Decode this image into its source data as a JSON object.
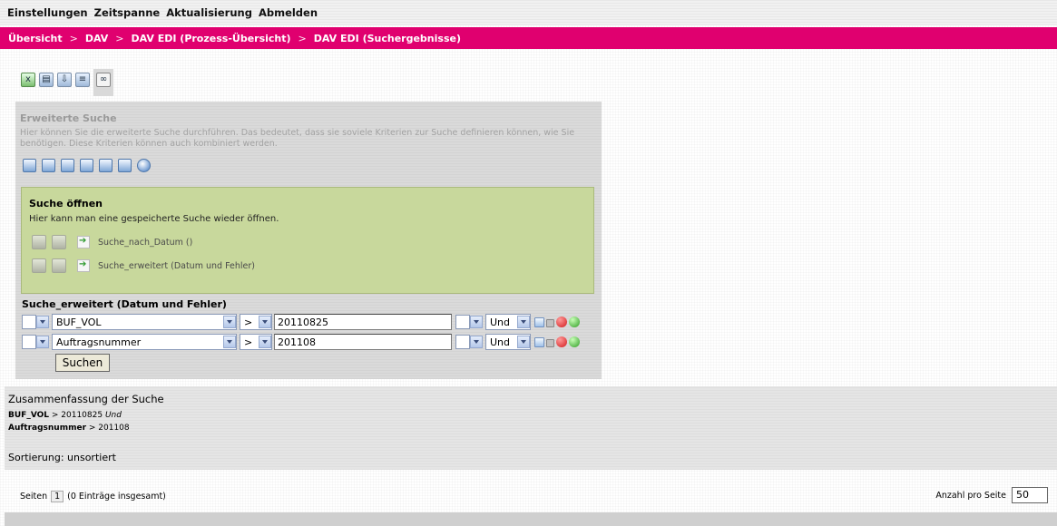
{
  "menu": [
    "Einstellungen",
    "Zeitspanne",
    "Aktualisierung",
    "Abmelden"
  ],
  "breadcrumbs": [
    "Übersicht",
    "DAV",
    "DAV EDI (Prozess-Übersicht)",
    "DAV EDI (Suchergebnisse)"
  ],
  "breadcrumb_separator": ">",
  "top_tools": [
    "excel-export-icon",
    "excel-icon",
    "import-icon",
    "list-view-icon",
    "binoculars-icon"
  ],
  "advanced": {
    "title": "Erweiterte Suche",
    "description": "Hier können Sie die erweiterte Suche durchführen. Das bedeutet, dass sie soviele Kriterien zur Suche definieren können, wie Sie benötigen. Diese Kriterien können auch kombiniert werden.",
    "tools": [
      "open-search-icon",
      "edit-search-icon",
      "save-search-icon",
      "add-criteria-icon",
      "remove-criteria-icon",
      "copy-icon",
      "help-icon"
    ]
  },
  "open_search": {
    "title": "Suche öffnen",
    "description": "Hier kann man eine gespeicherte Suche wieder öffnen.",
    "items": [
      "Suche_nach_Datum ()",
      "Suche_erweitert (Datum und Fehler)"
    ]
  },
  "criteria": {
    "title": "Suche_erweitert (Datum und Fehler)",
    "rows": [
      {
        "field": "BUF_VOL",
        "operator": ">",
        "value": "20110825",
        "logic": "Und"
      },
      {
        "field": "Auftragsnummer",
        "operator": ">",
        "value": "201108",
        "logic": "Und"
      }
    ],
    "search_button": "Suchen"
  },
  "summary": {
    "title": "Zusammenfassung der Suche",
    "line1_field": "BUF_VOL",
    "line1_rest": " > 20110825 ",
    "line1_logic": "Und",
    "line2_field": "Auftragsnummer",
    "line2_rest": " > 201108",
    "sort_label": "Sortierung:",
    "sort_value": " unsortiert"
  },
  "pager": {
    "label": "Seiten",
    "page": "1",
    "total": "(0 Einträge insgesamt)",
    "per_page_label": "Anzahl pro Seite",
    "per_page_value": "50"
  }
}
